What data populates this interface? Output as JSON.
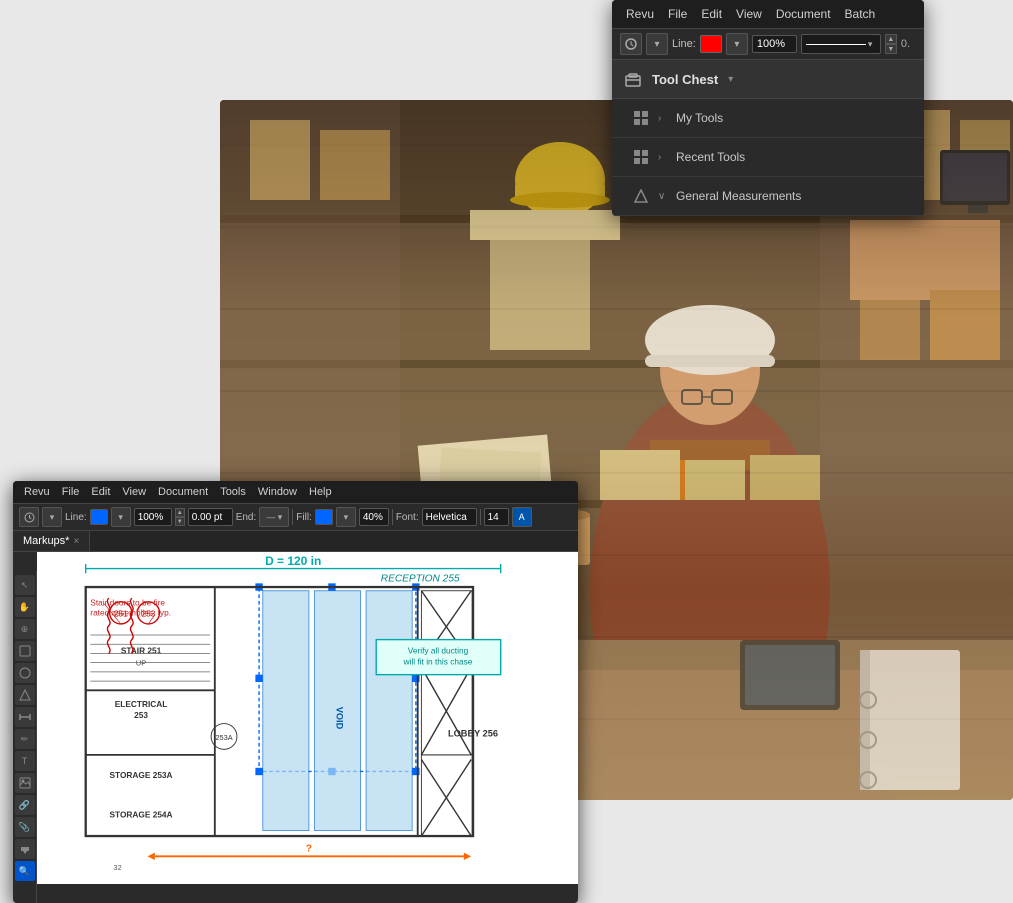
{
  "background": {
    "alt": "Construction worker reviewing blueprints in workshop"
  },
  "revu_popup": {
    "menu_bar": {
      "items": [
        "Revu",
        "File",
        "Edit",
        "View",
        "Document",
        "Batch"
      ]
    },
    "toolbar": {
      "line_label": "Line:",
      "percentage": "100%"
    },
    "tool_chest": {
      "title": "Tool Chest",
      "chevron": "▾",
      "items": [
        {
          "label": "My Tools",
          "arrow": "›",
          "icon": "grid"
        },
        {
          "label": "Recent Tools",
          "arrow": "›",
          "icon": "grid"
        }
      ],
      "sections": [
        {
          "label": "General Measurements",
          "arrow": "∨",
          "icon": "diamond"
        }
      ]
    }
  },
  "main_window": {
    "menu_bar": {
      "items": [
        "Revu",
        "File",
        "Edit",
        "View",
        "Document",
        "Tools",
        "Window",
        "Help"
      ]
    },
    "toolbar": {
      "line_label": "Line:",
      "color": "#0066ff",
      "percentage": "100%",
      "end_label": "End:",
      "fill_label": "Fill:",
      "fill_percent": "40%",
      "font_label": "Font:",
      "font_value": "Helvetica",
      "font_size": "14",
      "line_value": "0.00 pt"
    },
    "tab": {
      "label": "Markups*",
      "close": "×"
    },
    "blueprint": {
      "dimension_label": "D = 120 in",
      "reception_label": "RECEPTION  255",
      "stair_label": "STAIR  251",
      "electrical_label": "ELECTRICAL\n    253",
      "storage_253a_label": "STORAGE  253A",
      "storage_254a_label": "STORAGE  254A",
      "lobby_label": "LOBBY  256",
      "annotation_fire": "Stair doors to be fire\nrated assemblies, typ.",
      "annotation_duct": "Verify all ducting\nwill fit in this chase",
      "arrow_question": "?",
      "stair_up": "UP",
      "room_251": "251",
      "room_253": "253",
      "room_253a": "253A"
    }
  }
}
